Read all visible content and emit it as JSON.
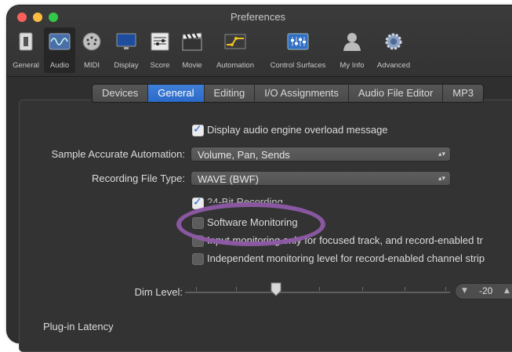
{
  "window": {
    "title": "Preferences"
  },
  "toolbar": {
    "items": [
      {
        "label": "General",
        "icon": "general-icon"
      },
      {
        "label": "Audio",
        "icon": "audio-icon",
        "selected": true
      },
      {
        "label": "MIDI",
        "icon": "midi-icon"
      },
      {
        "label": "Display",
        "icon": "display-icon"
      },
      {
        "label": "Score",
        "icon": "score-icon"
      },
      {
        "label": "Movie",
        "icon": "movie-icon"
      },
      {
        "label": "Automation",
        "icon": "automation-icon"
      },
      {
        "label": "Control Surfaces",
        "icon": "control-surfaces-icon"
      },
      {
        "label": "My Info",
        "icon": "my-info-icon"
      },
      {
        "label": "Advanced",
        "icon": "advanced-icon"
      }
    ]
  },
  "tabs": [
    {
      "label": "Devices"
    },
    {
      "label": "General",
      "active": true
    },
    {
      "label": "Editing"
    },
    {
      "label": "I/O Assignments"
    },
    {
      "label": "Audio File Editor"
    },
    {
      "label": "MP3"
    }
  ],
  "settings": {
    "overload_label": "Display audio engine overload message",
    "overload_checked": true,
    "sample_accurate_label": "Sample Accurate Automation:",
    "sample_accurate_value": "Volume, Pan, Sends",
    "recording_type_label": "Recording File Type:",
    "recording_type_value": "WAVE (BWF)",
    "bit24_label": "24-Bit Recording",
    "bit24_checked": true,
    "software_monitoring_label": "Software Monitoring",
    "software_monitoring_checked": false,
    "input_monitoring_label": "Input monitoring only for focused track, and record-enabled tr",
    "input_monitoring_checked": false,
    "independent_label": "Independent monitoring level for record-enabled channel strip",
    "independent_checked": false,
    "dim_level_label": "Dim Level:",
    "dim_level_value": "-20",
    "plugin_latency_label": "Plug-in Latency"
  },
  "colors": {
    "accent": "#2c6ac9",
    "highlight_ellipse": "#8e5aa6",
    "window_bg": "#333333"
  }
}
